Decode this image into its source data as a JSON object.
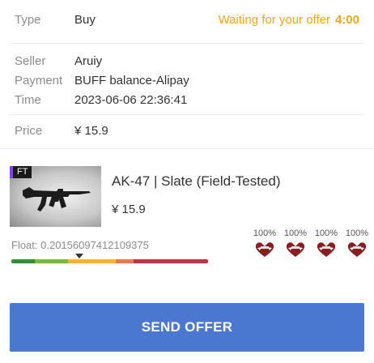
{
  "order": {
    "type_label": "Type",
    "type_value": "Buy",
    "waiting_text": "Waiting for your offer",
    "countdown": "4:00",
    "seller_label": "Seller",
    "seller_value": "Aruiy",
    "payment_label": "Payment",
    "payment_value": "BUFF balance-Alipay",
    "time_label": "Time",
    "time_value": "2023-06-06 22:36:41",
    "price_label": "Price",
    "price_value": "¥ 15.9"
  },
  "item": {
    "wear_badge": "FT",
    "name": "AK-47 | Slate (Field-Tested)",
    "price": "¥ 15.9",
    "float_text": "Float: 0.20156097412109375",
    "float_value": 0.20156097412109375,
    "stickers": [
      {
        "wear": "100%",
        "icon": "sticker-icon"
      },
      {
        "wear": "100%",
        "icon": "sticker-icon"
      },
      {
        "wear": "100%",
        "icon": "sticker-icon"
      },
      {
        "wear": "100%",
        "icon": "sticker-icon"
      }
    ]
  },
  "action": {
    "send_label": "SEND OFFER"
  },
  "colors": {
    "accent": "#4a78d0",
    "warning": "#f0a81c"
  }
}
